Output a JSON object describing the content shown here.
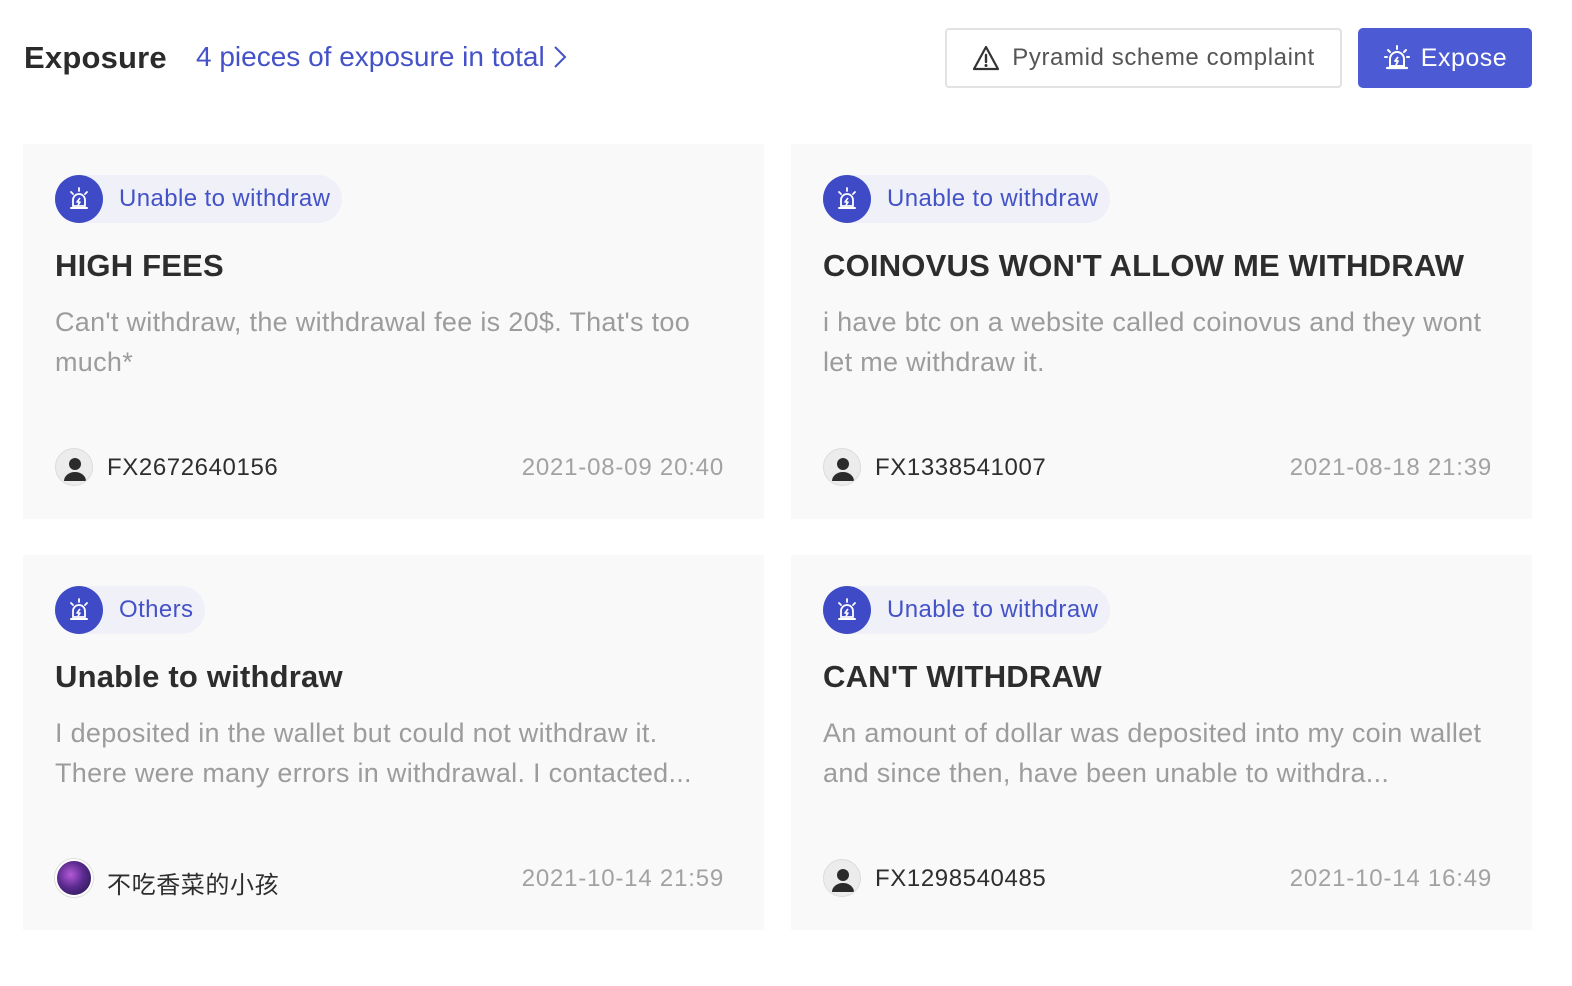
{
  "header": {
    "title": "Exposure",
    "summary_link": "4 pieces of exposure in total",
    "complaint_button": "Pyramid scheme complaint",
    "expose_button": "Expose"
  },
  "cards": [
    {
      "tag": "Unable to withdraw",
      "title": "HIGH FEES",
      "body": "Can't withdraw, the withdrawal fee is 20$. That's too much*",
      "user": "FX2672640156",
      "date": "2021-08-09 20:40",
      "avatar": "default-avatar"
    },
    {
      "tag": "Unable to withdraw",
      "title": "COINOVUS WON'T ALLOW ME WITHDRAW",
      "body": "i have btc on a website called coinovus and they wont let me withdraw it.",
      "user": "FX1338541007",
      "date": "2021-08-18 21:39",
      "avatar": "default-avatar"
    },
    {
      "tag": "Others",
      "title": "Unable to withdraw",
      "body": "I deposited in the wallet but could not withdraw it. There were many errors in withdrawal. I contacted...",
      "user": "不吃香菜的小孩",
      "date": "2021-10-14 21:59",
      "avatar": "photo-avatar"
    },
    {
      "tag": "Unable to withdraw",
      "title": "CAN'T WITHDRAW",
      "body": "An amount of dollar was deposited into my coin wallet and since then, have been unable to withdra...",
      "user": "FX1298540485",
      "date": "2021-10-14 16:49",
      "avatar": "default-avatar"
    }
  ],
  "colors": {
    "accent": "#4c5bd4",
    "tag_bg": "#eff0f8",
    "card_bg": "#f9f9fa"
  },
  "icons": {
    "summary_link": "chevron-right-icon",
    "complaint_button": "warning-triangle-icon",
    "expose_button": "alarm-siren-icon",
    "tag": "alarm-siren-icon",
    "avatar": "user-silhouette-icon"
  }
}
